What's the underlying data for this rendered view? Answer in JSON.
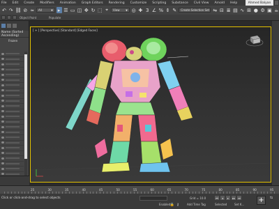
{
  "menubar": {
    "items": [
      "File",
      "Edit",
      "Create",
      "Modifiers",
      "Animation",
      "Graph Editors",
      "Rendering",
      "Customize",
      "Scripting",
      "Substance",
      "Civil View",
      "Arnold",
      "Help"
    ],
    "user": "Ahmed Balyan"
  },
  "toolbar": {
    "selection_filter": "All",
    "create_selection_set": "Create Selection Set",
    "reference_coord": "View"
  },
  "ribbon": {
    "object_paint": "Object Paint",
    "populate": "Populate"
  },
  "explorer": {
    "header": "Name (Sorted Ascending)",
    "sub_item": "Frozen"
  },
  "viewport": {
    "label_prefix": "[ + ]",
    "view": "[Perspective]",
    "shading": "[Standard]",
    "mode": "[Edged Faces]",
    "viewcube_label": "RIGHT"
  },
  "timeline": {
    "ticks": [
      "25",
      "30",
      "35",
      "40",
      "45",
      "50",
      "55",
      "60",
      "65",
      "70",
      "75",
      "80",
      "85",
      "90",
      "95"
    ]
  },
  "statusbar": {
    "prompt": "Click or click-and-drag to select objects",
    "grid": "Grid = 10.0",
    "add_time_tag": "Add Time Tag",
    "selected": "Selected",
    "enabled_label": "Enabled:",
    "set_key": "Set K..."
  },
  "colors": {
    "viewport_border": "#e4c200",
    "accent": "#5b7fa8"
  }
}
